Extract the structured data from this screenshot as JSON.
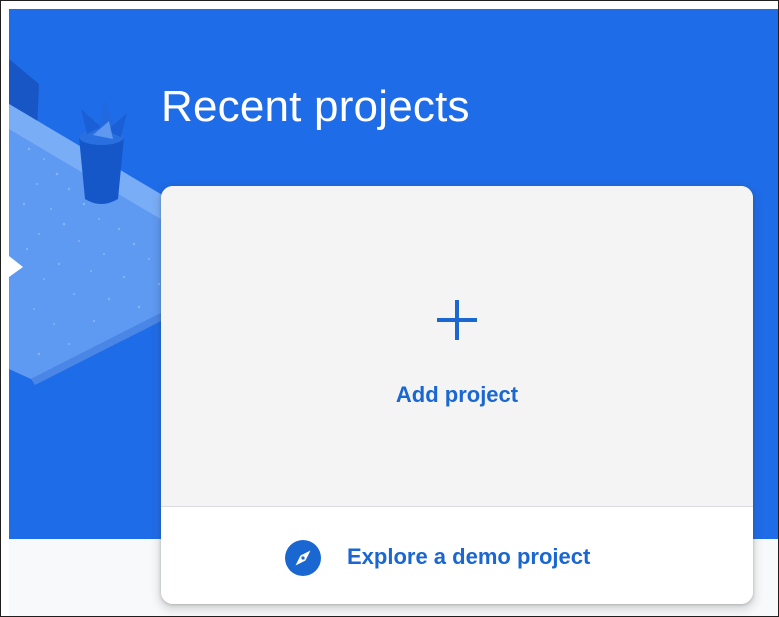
{
  "header": {
    "title": "Recent projects"
  },
  "card": {
    "add_project": {
      "label": "Add project",
      "icon": "plus-icon"
    },
    "explore_demo": {
      "label": "Explore a demo project",
      "icon": "compass-icon"
    }
  },
  "colors": {
    "hero_background": "#1f6ce8",
    "accent_text": "#1a67d2",
    "add_tile_background": "#f4f4f4",
    "card_background": "#ffffff"
  }
}
